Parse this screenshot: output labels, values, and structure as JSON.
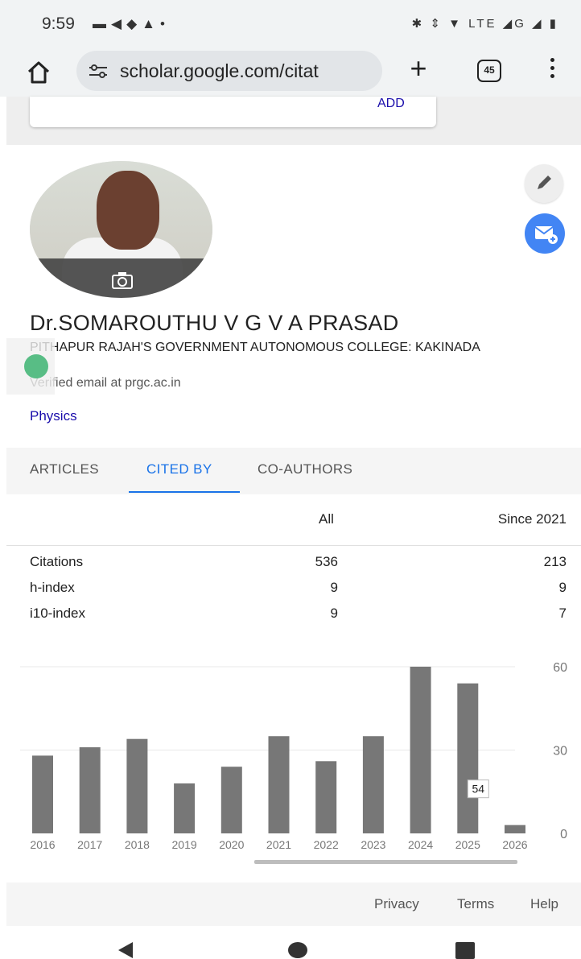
{
  "status_bar": {
    "time": "9:59",
    "left_icons": "▬◀◆▲•",
    "right_icons": "✱ ⇕ ▼ LTE ◢G ◢ ▮",
    "icons": [
      "gallery-icon",
      "send-icon",
      "chat-icon",
      "warning-icon",
      "bluetooth-icon",
      "data-icon",
      "wifi-icon",
      "signal-icon",
      "battery-icon"
    ]
  },
  "browser": {
    "url": "scholar.google.com/citat",
    "tab_count": "45",
    "new_tab_label": "+"
  },
  "top_card": {
    "add_label": "ADD"
  },
  "profile": {
    "name": "Dr.SOMAROUTHU V G V A PRASAD",
    "affiliation": "PITHAPUR RAJAH'S GOVERNMENT AUTONOMOUS COLLEGE: KAKINADA",
    "verified_email": "Verified email at prgc.ac.in",
    "interest": "Physics"
  },
  "tabs": [
    {
      "label": "ARTICLES",
      "active": false
    },
    {
      "label": "CITED BY",
      "active": true
    },
    {
      "label": "CO-AUTHORS",
      "active": false
    }
  ],
  "citations_table": {
    "headers": [
      "All",
      "Since 2021"
    ],
    "rows": [
      {
        "label": "Citations",
        "all": "536",
        "since": "213"
      },
      {
        "label": "h-index",
        "all": "9",
        "since": "9"
      },
      {
        "label": "i10-index",
        "all": "9",
        "since": "7"
      }
    ]
  },
  "chart_data": {
    "type": "bar",
    "categories": [
      "2016",
      "2017",
      "2018",
      "2019",
      "2020",
      "2021",
      "2022",
      "2023",
      "2024",
      "2025",
      "2026"
    ],
    "values": [
      28,
      31,
      34,
      18,
      24,
      35,
      26,
      35,
      60,
      54,
      3
    ],
    "tooltip": {
      "category": "2025",
      "label": "54"
    },
    "yticks": [
      0,
      30,
      60
    ],
    "ylim": [
      0,
      60
    ],
    "grid": true,
    "colors": {
      "bar": "#777777",
      "grid": "#e8e8e8"
    }
  },
  "footer": {
    "links": [
      "Privacy",
      "Terms",
      "Help"
    ]
  },
  "colors": {
    "accent": "#1a73e8",
    "link": "#1a0dab",
    "mail_button": "#4285f4"
  }
}
